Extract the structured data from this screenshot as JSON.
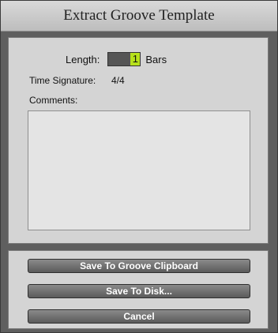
{
  "title": "Extract Groove Template",
  "length": {
    "label": "Length:",
    "value": "1",
    "unit": "Bars"
  },
  "time_signature": {
    "label": "Time Signature:",
    "value": "4/4"
  },
  "comments": {
    "label": "Comments:",
    "value": ""
  },
  "buttons": {
    "save_clipboard": "Save To Groove Clipboard",
    "save_disk": "Save To Disk...",
    "cancel": "Cancel"
  }
}
